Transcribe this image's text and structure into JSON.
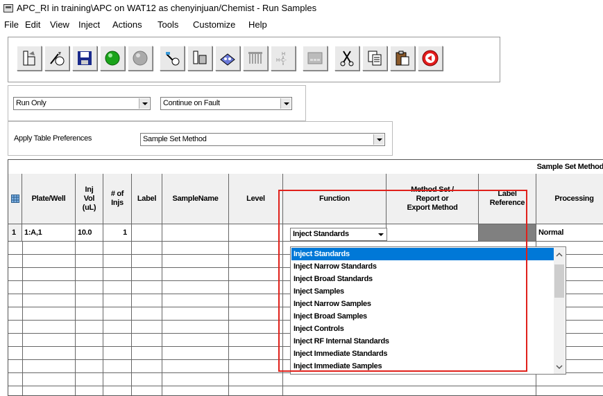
{
  "window": {
    "title": "APC_RI in training\\APC on WAT12 as chenyinjuan/Chemist - Run Samples"
  },
  "menu": [
    "File",
    "Edit",
    "View",
    "Inject",
    "Actions",
    "Tools",
    "Customize",
    "Help"
  ],
  "toolbar": {
    "buttons": [
      "open-samples-icon",
      "new-method-icon",
      "save-icon",
      "run-green-icon",
      "stop-gray-icon",
      "inject-icon",
      "vials-icon",
      "plate-icon",
      "column-icon",
      "structure-icon",
      "grid-disabled-icon",
      "cut-icon",
      "copy-icon",
      "paste-icon",
      "abort-red-icon"
    ]
  },
  "controls": {
    "run_mode": "Run Only",
    "fault_mode": "Continue on Fault",
    "apply_label": "Apply Table Preferences",
    "preference": "Sample Set Method"
  },
  "grid": {
    "group_header": "Sample Set Method",
    "columns": [
      "Plate/Well",
      "Inj\nVol\n(uL)",
      "# of\nInjs",
      "Label",
      "SampleName",
      "Level",
      "Function",
      "Method Set /\nReport or\nExport Method",
      "Label\nReference",
      "Processing"
    ],
    "row1": {
      "index": "1",
      "plate_well": "1:A,1",
      "inj_vol": "10.0",
      "injs": "1",
      "function": "Inject Standards",
      "processing": "Normal"
    }
  },
  "dropdown": {
    "options": [
      "Inject Standards",
      "Inject Narrow Standards",
      "Inject Broad Standards",
      "Inject Samples",
      "Inject Narrow Samples",
      "Inject Broad Samples",
      "Inject Controls",
      "Inject RF Internal Standards",
      "Inject Immediate Standards",
      "Inject Immediate Samples"
    ],
    "selected_index": 0
  },
  "colors": {
    "highlight": "#0078d7",
    "annotation_box": "#e0201a"
  }
}
